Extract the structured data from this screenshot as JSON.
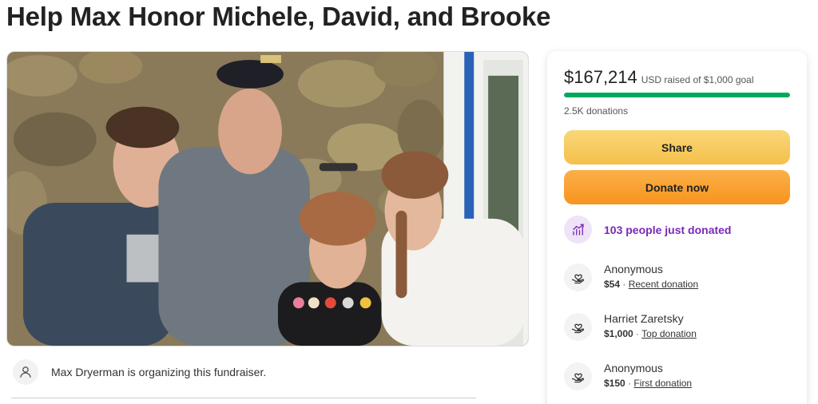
{
  "page": {
    "title": "Help Max Honor Michele, David, and Brooke"
  },
  "organizer": {
    "text": "Max Dryerman is organizing this fundraiser.",
    "avatar_icon": "user-icon"
  },
  "card": {
    "raised_amount": "$167,214",
    "raised_text": "USD raised of $1,000 goal",
    "progress_fraction": 1.0,
    "donation_count": "2.5K donations",
    "share_label": "Share",
    "donate_label": "Donate now",
    "trend_text": "103 people just donated",
    "trend_icon": "trending-up-icon",
    "donations": [
      {
        "name": "Anonymous",
        "amount": "$54",
        "separator": "·",
        "tag": "Recent donation",
        "icon": "heart-hand-icon"
      },
      {
        "name": "Harriet Zaretsky",
        "amount": "$1,000",
        "separator": "·",
        "tag": "Top donation",
        "icon": "heart-hand-icon"
      },
      {
        "name": "Anonymous",
        "amount": "$150",
        "separator": "·",
        "tag": "First donation",
        "icon": "heart-hand-icon"
      }
    ]
  },
  "colors": {
    "progress": "#02a95c",
    "share_button": "#f5c04b",
    "donate_button": "#f7941e",
    "trend_text": "#7a28b8"
  }
}
